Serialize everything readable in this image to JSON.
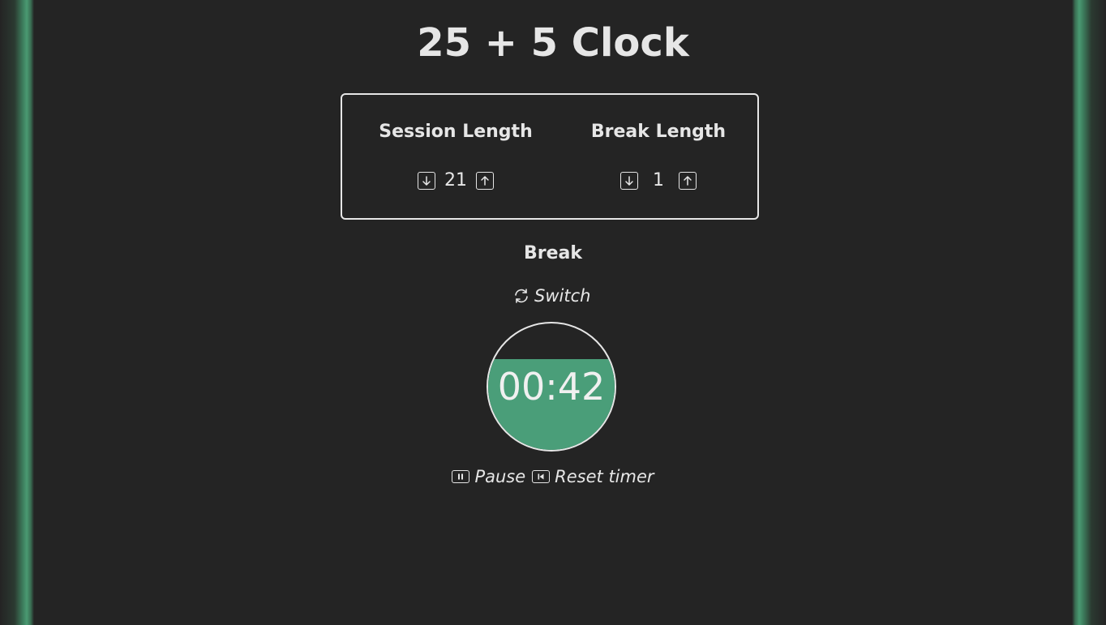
{
  "app": {
    "title": "25 + 5 Clock"
  },
  "settings": {
    "session": {
      "label": "Session Length",
      "value": "21",
      "decrement_icon": "arrow-down-icon",
      "increment_icon": "arrow-up-icon"
    },
    "break": {
      "label": "Break Length",
      "value": "1",
      "decrement_icon": "arrow-down-icon",
      "increment_icon": "arrow-up-icon"
    }
  },
  "timer": {
    "mode_label": "Break",
    "switch_label": "Switch",
    "switch_icon": "refresh-icon",
    "display": "00:42",
    "progress_fraction": 0.72
  },
  "controls": {
    "pause_label": "Pause",
    "pause_icon": "pause-icon",
    "reset_label": "Reset timer",
    "reset_icon": "skip-back-icon"
  },
  "colors": {
    "background": "#242424",
    "accent": "#4a9e79",
    "text": "#e6e6e6"
  }
}
